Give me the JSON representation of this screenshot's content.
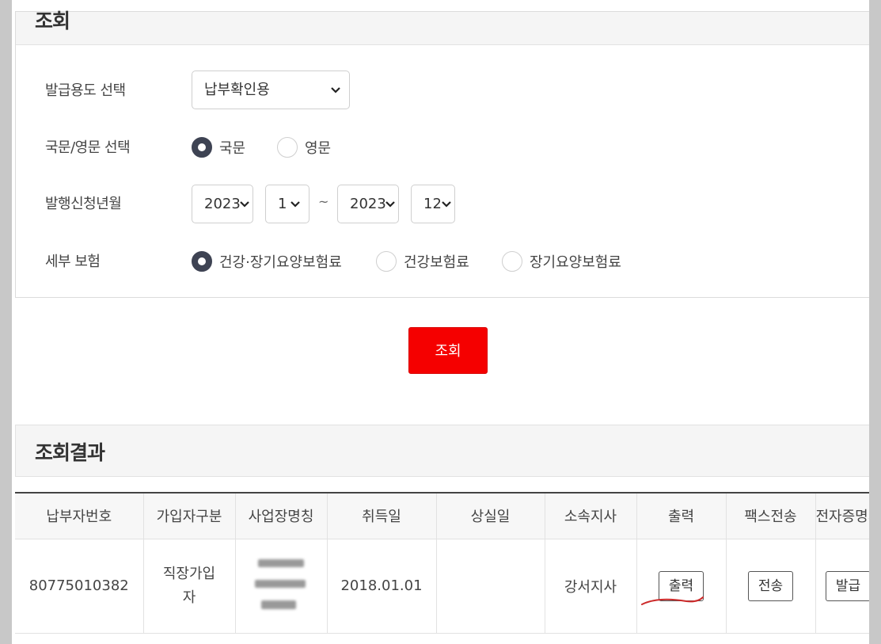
{
  "query": {
    "title": "조회",
    "purpose_label": "발급용도 선택",
    "purpose_value": "납부확인용",
    "language_label": "국문/영문 선택",
    "language_options": [
      "국문",
      "영문"
    ],
    "language_selected": "국문",
    "period_label": "발행신청년월",
    "from_year": "2023",
    "from_month": "1",
    "separator": "~",
    "to_year": "2023",
    "to_month": "12",
    "insurance_label": "세부 보험",
    "insurance_options": [
      "건강·장기요양보험료",
      "건강보험료",
      "장기요양보험료"
    ],
    "insurance_selected": "건강·장기요양보험료",
    "search_button": "조회"
  },
  "results": {
    "title": "조회결과",
    "columns": [
      "납부자번호",
      "가입자구분",
      "사업장명칭",
      "취득일",
      "상실일",
      "소속지사",
      "출력",
      "팩스전송",
      "전자증명서"
    ],
    "rows": [
      {
        "payer_no": "80775010382",
        "member_type": "직장가입자",
        "workplace": "",
        "acquired": "2018.01.01",
        "lost": "",
        "branch": "강서지사",
        "print_btn": "출력",
        "fax_btn": "전송",
        "cert_btn": "발급"
      }
    ]
  },
  "colors": {
    "accent": "#f50000",
    "radio_checked": "#3e4353",
    "annotation": "#cc2a2a"
  },
  "icons": [
    "chevron-down-icon"
  ]
}
